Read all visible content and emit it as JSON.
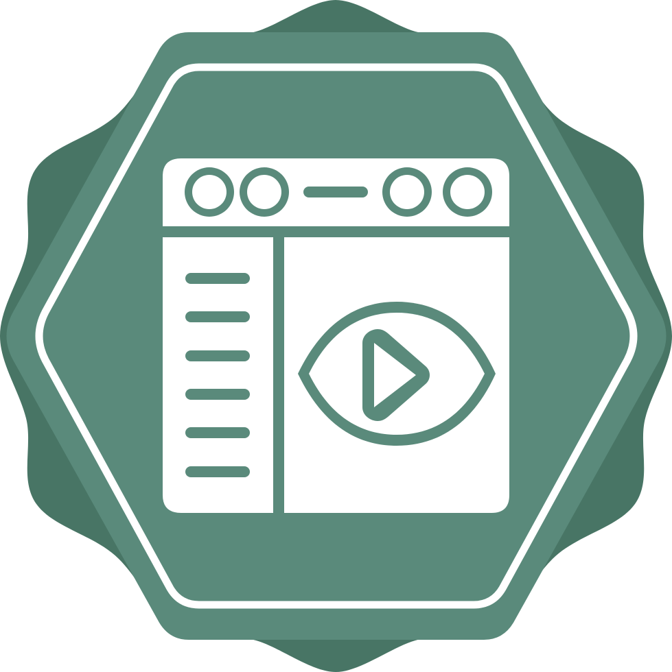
{
  "icon": {
    "name": "web-video-watch-icon",
    "colors": {
      "background": "#ffffff",
      "badge_outer": "#487565",
      "badge_inner": "#5a8a7b",
      "foreground": "#ffffff"
    }
  }
}
